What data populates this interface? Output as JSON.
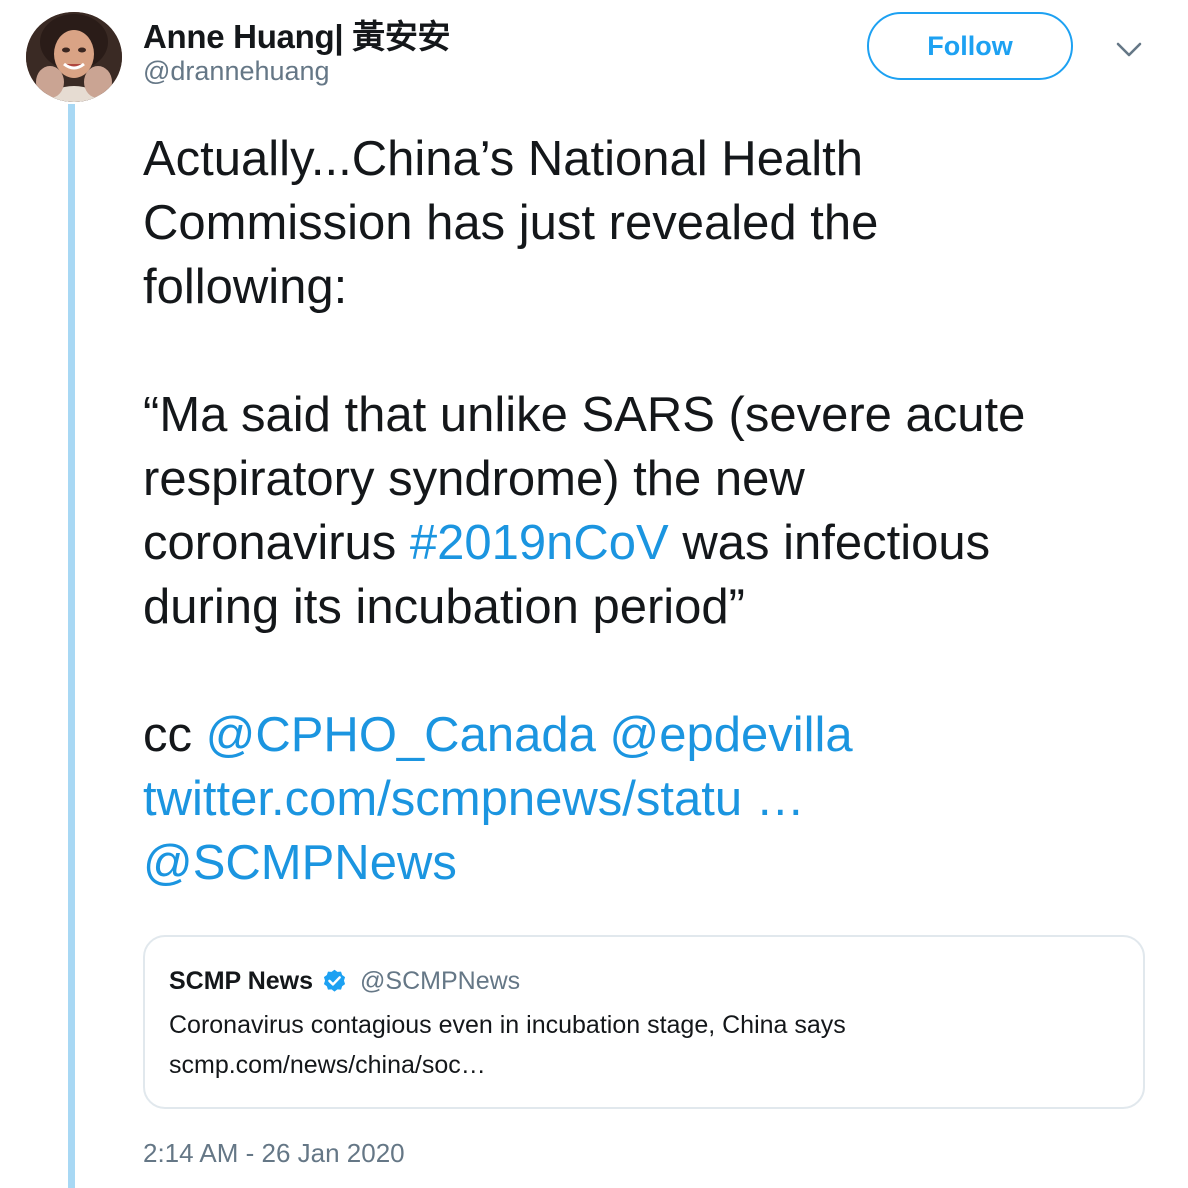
{
  "author": {
    "name": "Anne Huang| 黃安安",
    "handle": "@drannehuang"
  },
  "follow_button": {
    "label": "Follow"
  },
  "colors": {
    "accent": "#1da1f2",
    "link": "#1b95e0",
    "thread_line": "#a8d8f4",
    "secondary_text": "#657786"
  },
  "tweet": {
    "line1": "Actually...China’s National Health",
    "line2": "Commission has just revealed the",
    "line3": "following:",
    "quote_line1": "“Ma said that unlike SARS (severe acute",
    "quote_line2": "respiratory syndrome) the new",
    "quote_line3_prefix": "coronavirus ",
    "hashtag": "#2019nCoV",
    "quote_line3_suffix": " was infectious",
    "quote_line4": "during its incubation period”",
    "cc_prefix": "cc ",
    "mention_cpho": "@CPHO_Canada",
    "mention_epdevilla": "@epdevilla",
    "url_link": "twitter.com/scmpnews/statu …",
    "mention_scmp": "@SCMPNews"
  },
  "quoted_tweet": {
    "name": "SCMP News",
    "handle": "@SCMPNews",
    "verified_icon": "verified-badge-icon",
    "text": "Coronavirus contagious even in incubation stage, China says",
    "url": "scmp.com/news/china/soc…"
  },
  "timestamp": "2:14 AM - 26 Jan 2020"
}
